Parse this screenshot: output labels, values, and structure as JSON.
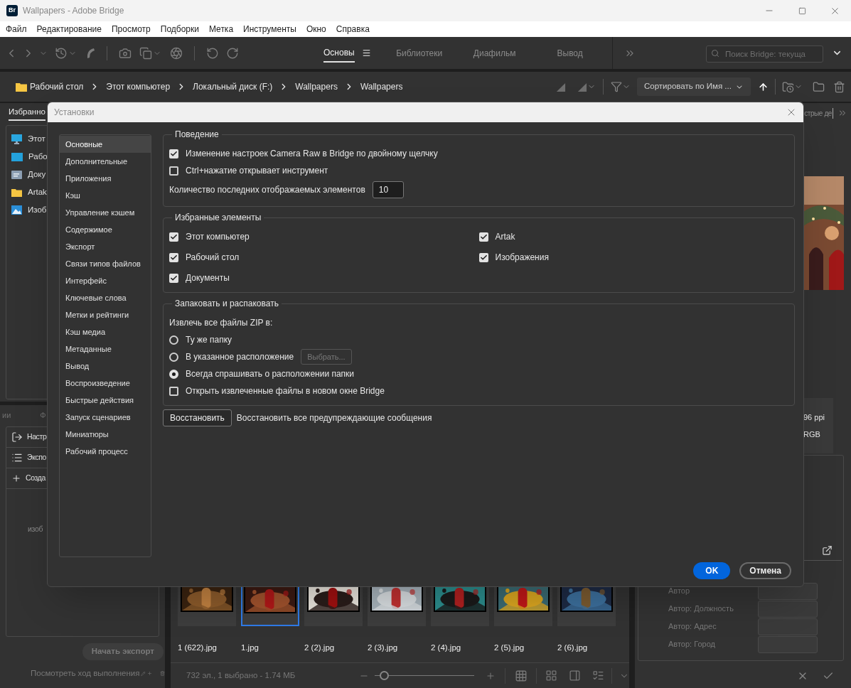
{
  "window": {
    "badge": "Br",
    "title": "Wallpapers - Adobe Bridge"
  },
  "menu": [
    "Файл",
    "Редактирование",
    "Просмотр",
    "Подборки",
    "Метка",
    "Инструменты",
    "Окно",
    "Справка"
  ],
  "workspaces": [
    {
      "label": "Основы",
      "selected": true
    },
    {
      "label": "Библиотеки",
      "selected": false
    },
    {
      "label": "Диафильм",
      "selected": false
    },
    {
      "label": "Вывод",
      "selected": false
    }
  ],
  "search": {
    "placeholder": "Поиск Bridge: текуща"
  },
  "breadcrumbs": [
    "Рабочий стол",
    "Этот компьютер",
    "Локальный диск (F:)",
    "Wallpapers",
    "Wallpapers"
  ],
  "sort": {
    "label": "Сортировать по Имя ..."
  },
  "favorites_panel": {
    "tab": "Избранно",
    "items": [
      {
        "label": "Этот",
        "kind": "computer"
      },
      {
        "label": "Рабо",
        "kind": "desktop"
      },
      {
        "label": "Доку",
        "kind": "documents"
      },
      {
        "label": "Artak",
        "kind": "folder"
      },
      {
        "label": "Изоб",
        "kind": "pictures"
      }
    ]
  },
  "export_panel": {
    "tabs": [
      "ии",
      "Ф"
    ],
    "items": [
      {
        "label": "Настр",
        "kind": "export"
      },
      {
        "label": "Экспо",
        "kind": "list"
      },
      {
        "label": "Созда",
        "kind": "add"
      }
    ],
    "hint": "изоб",
    "start_button": "Начать экспорт",
    "progress_link": "Посмотреть ход выполнения"
  },
  "thumbnails": [
    {
      "name": "1 (622).jpg",
      "selected": false
    },
    {
      "name": "1.jpg",
      "selected": true
    },
    {
      "name": "2 (2).jpg",
      "selected": false
    },
    {
      "name": "2 (3).jpg",
      "selected": false
    },
    {
      "name": "2 (4).jpg",
      "selected": false
    },
    {
      "name": "2 (5).jpg",
      "selected": false
    },
    {
      "name": "2 (6).jpg",
      "selected": false
    }
  ],
  "status": "732 эл., 1 выбрано - 1.74 МБ",
  "zoom": {
    "level": 0.05
  },
  "right_panel": {
    "tab": "стрые де",
    "info": [
      "96 ppi",
      "RGB"
    ],
    "metadata": [
      "Автор",
      "Автор: Должность",
      "Автор: Адрес",
      "Автор: Город"
    ]
  },
  "dialog": {
    "title": "Установки",
    "categories": [
      {
        "label": "Основные",
        "selected": true
      },
      {
        "label": "Дополнительные",
        "selected": false
      },
      {
        "label": "Приложения",
        "selected": false
      },
      {
        "label": "Кэш",
        "selected": false
      },
      {
        "label": "Управление кэшем",
        "selected": false
      },
      {
        "label": "Содержимое",
        "selected": false
      },
      {
        "label": "Экспорт",
        "selected": false
      },
      {
        "label": "Связи типов файлов",
        "selected": false
      },
      {
        "label": "Интерфейс",
        "selected": false
      },
      {
        "label": "Ключевые слова",
        "selected": false
      },
      {
        "label": "Метки и рейтинги",
        "selected": false
      },
      {
        "label": "Кэш медиа",
        "selected": false
      },
      {
        "label": "Метаданные",
        "selected": false
      },
      {
        "label": "Вывод",
        "selected": false
      },
      {
        "label": "Воспроизведение",
        "selected": false
      },
      {
        "label": "Быстрые действия",
        "selected": false
      },
      {
        "label": "Запуск сценариев",
        "selected": false
      },
      {
        "label": "Миниатюры",
        "selected": false
      },
      {
        "label": "Рабочий процесс",
        "selected": false
      }
    ],
    "groups": [
      {
        "title": "Поведение",
        "kind": "rows",
        "rows": [
          {
            "kind": "checkbox",
            "label": "Изменение настроек Camera Raw в Bridge по двойному щелчку",
            "checked": true
          },
          {
            "kind": "checkbox",
            "label": "Ctrl+нажатие открывает инструмент",
            "checked": false
          },
          {
            "kind": "number",
            "label": "Количество последних отображаемых элементов",
            "value": "10"
          }
        ]
      },
      {
        "title": "Избранные элементы",
        "kind": "columns",
        "rows": [
          {
            "kind": "checkbox",
            "label": "Этот компьютер",
            "checked": true
          },
          {
            "kind": "checkbox",
            "label": "Рабочий стол",
            "checked": true
          },
          {
            "kind": "checkbox",
            "label": "Документы",
            "checked": true
          },
          {
            "kind": "checkbox",
            "label": "Artak",
            "checked": true
          },
          {
            "kind": "checkbox",
            "label": "Изображения",
            "checked": true
          }
        ]
      },
      {
        "title": "Запаковать и распаковать",
        "kind": "rows",
        "rows": [
          {
            "kind": "label",
            "label": "Извлечь все файлы ZIP в:"
          },
          {
            "kind": "radio",
            "label": "Ту же папку",
            "selected": false
          },
          {
            "kind": "radio",
            "label": "В указанное расположение",
            "selected": false,
            "button": {
              "label": "Выбрать...",
              "disabled": true
            }
          },
          {
            "kind": "radio",
            "label": "Всегда спрашивать о расположении папки",
            "selected": true
          },
          {
            "kind": "checkbox",
            "label": "Открыть извлеченные файлы в новом окне Bridge",
            "checked": false
          }
        ]
      }
    ],
    "reset": {
      "button": "Восстановить",
      "text": "Восстановить все предупреждающие сообщения"
    },
    "buttons": [
      {
        "label": "OK",
        "kind": "primary"
      },
      {
        "label": "Отмена",
        "kind": "secondary"
      }
    ]
  }
}
